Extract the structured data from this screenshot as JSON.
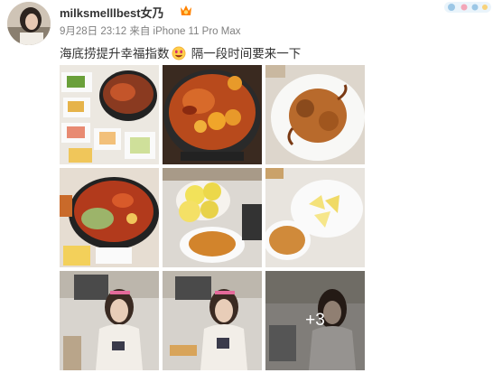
{
  "post": {
    "username": "milksmelllbest女乃",
    "meta": "9月28日 23:12 来自 iPhone 11 Pro Max",
    "text_before": "海底捞提升幸福指数",
    "text_after": " 隔一段时间要来一下"
  },
  "gallery": {
    "count": 9,
    "more_label": "+3"
  },
  "icons": {
    "vip_badge": "vip-badge-icon",
    "emoji": "drooling-face-emoji",
    "corner": "decorative-sticker-icon"
  }
}
